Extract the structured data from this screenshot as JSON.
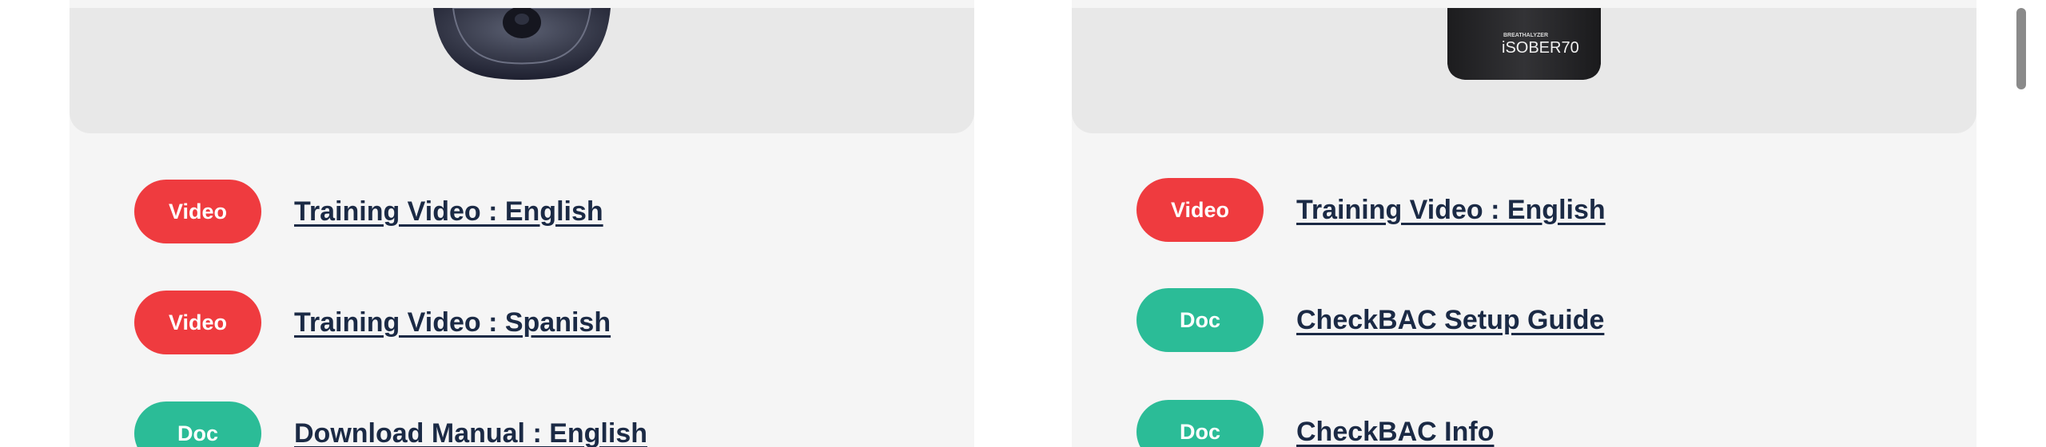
{
  "colors": {
    "video_badge": "#ef3b3f",
    "doc_badge": "#2bbc97",
    "link_text": "#1b2a45",
    "card_bg": "#f5f5f5",
    "image_bg": "#e8e8e8"
  },
  "cards": [
    {
      "product_image": "breathalyzer-camera-image",
      "resources": [
        {
          "badge": "Video",
          "label": "Training Video : English"
        },
        {
          "badge": "Video",
          "label": "Training Video : Spanish"
        },
        {
          "badge": "Doc",
          "label": "Download Manual : English"
        }
      ]
    },
    {
      "product_image": "isober-70-device-image",
      "device_brand": "BREATHALYZER",
      "device_model": "iSOBER70",
      "resources": [
        {
          "badge": "Video",
          "label": "Training Video : English"
        },
        {
          "badge": "Doc",
          "label": "CheckBAC Setup Guide"
        },
        {
          "badge": "Doc",
          "label": "CheckBAC Info"
        }
      ]
    }
  ]
}
